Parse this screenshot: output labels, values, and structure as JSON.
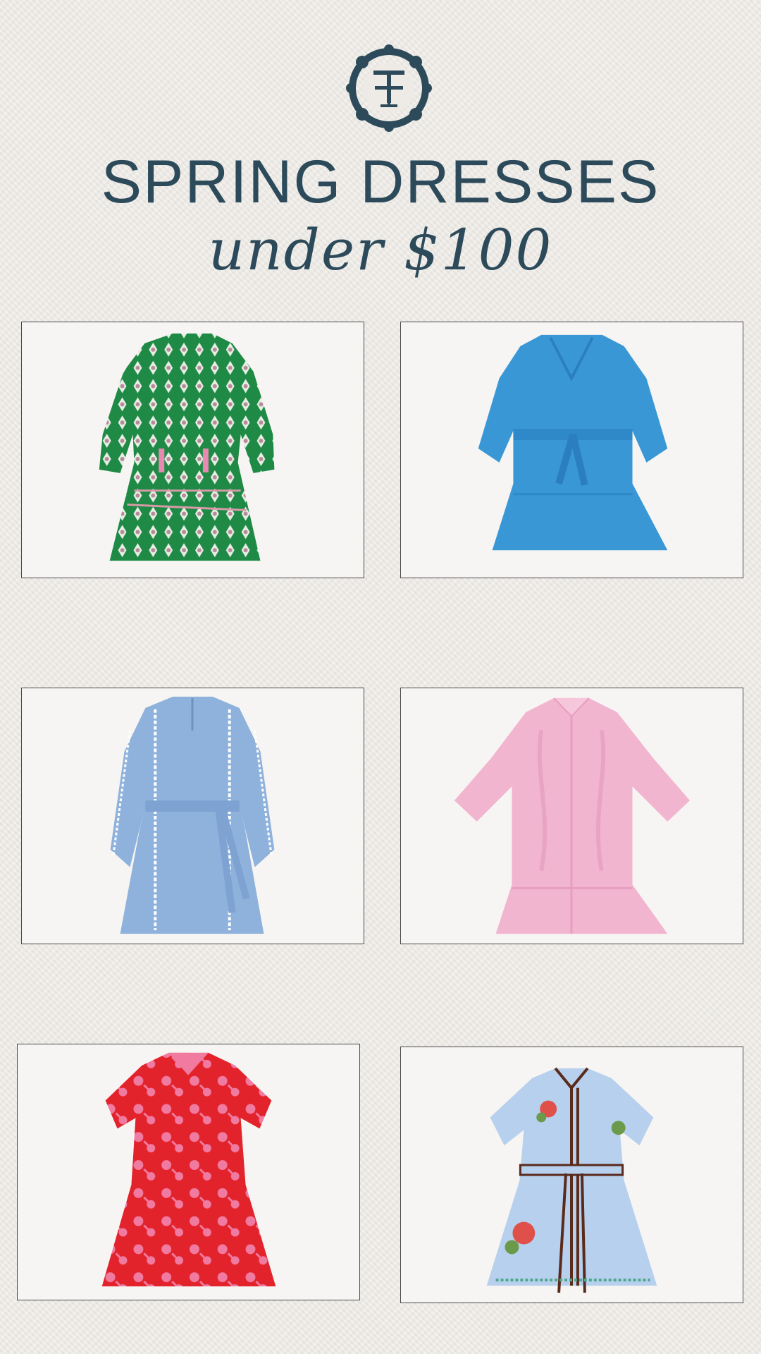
{
  "header": {
    "logo": "tt-monogram-logo",
    "title": "SPRING DRESSES",
    "subtitle": "under $100"
  },
  "products": [
    {
      "name": "green-print-tiered-dress",
      "color": "#1f8a45"
    },
    {
      "name": "blue-belted-tiered-dress",
      "color": "#3a97d6"
    },
    {
      "name": "chambray-lace-trim-dress",
      "color": "#8fb2dc"
    },
    {
      "name": "pink-embroidered-shirt-dress",
      "color": "#f2b5cf"
    },
    {
      "name": "red-floral-shirt-dress",
      "color": "#e2232c"
    },
    {
      "name": "light-blue-embroidered-belted-dress",
      "color": "#b6d0ee"
    }
  ]
}
